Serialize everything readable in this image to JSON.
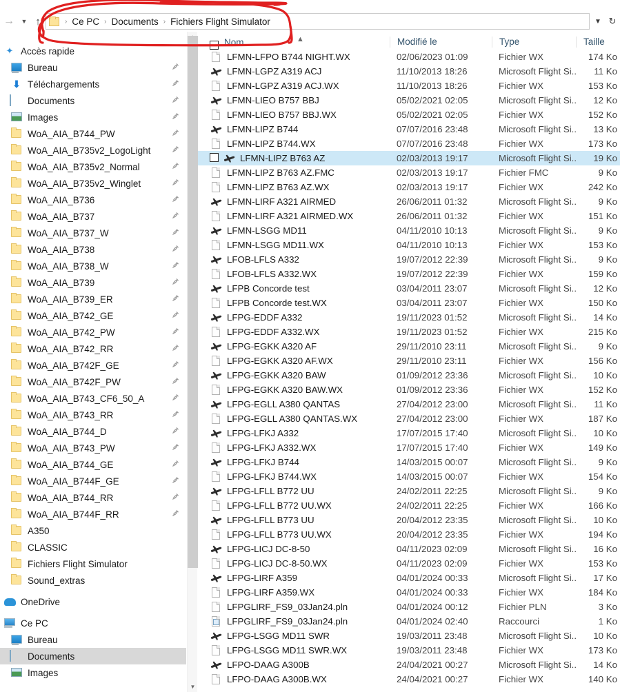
{
  "window": {
    "app": "File Explorer",
    "nav": {
      "back_icon": "arrow-left-icon",
      "forward_icon": "arrow-right-icon",
      "recent_icon": "chevron-down-icon",
      "up_icon": "arrow-up-icon",
      "address_caret_icon": "chevron-down-icon",
      "refresh_icon": "refresh-icon"
    },
    "breadcrumb": {
      "folder_icon": "folder-icon",
      "separator": "›",
      "items": [
        "Ce PC",
        "Documents",
        "Fichiers Flight Simulator"
      ]
    }
  },
  "sidebar": {
    "items": [
      {
        "label": "Accès rapide",
        "icon": "star-icon",
        "indent": 0,
        "pin": false,
        "selected": false
      },
      {
        "label": "Bureau",
        "icon": "desktop-icon",
        "indent": 1,
        "pin": true,
        "selected": false
      },
      {
        "label": "Téléchargements",
        "icon": "download-icon",
        "indent": 1,
        "pin": true,
        "selected": false
      },
      {
        "label": "Documents",
        "icon": "documents-icon",
        "indent": 1,
        "pin": true,
        "selected": false
      },
      {
        "label": "Images",
        "icon": "pictures-icon",
        "indent": 1,
        "pin": true,
        "selected": false
      },
      {
        "label": "WoA_AIA_B744_PW",
        "icon": "folder-icon",
        "indent": 1,
        "pin": true,
        "selected": false
      },
      {
        "label": "WoA_AIA_B735v2_LogoLight",
        "icon": "folder-icon",
        "indent": 1,
        "pin": true,
        "selected": false
      },
      {
        "label": "WoA_AIA_B735v2_Normal",
        "icon": "folder-icon",
        "indent": 1,
        "pin": true,
        "selected": false
      },
      {
        "label": "WoA_AIA_B735v2_Winglet",
        "icon": "folder-icon",
        "indent": 1,
        "pin": true,
        "selected": false
      },
      {
        "label": "WoA_AIA_B736",
        "icon": "folder-icon",
        "indent": 1,
        "pin": true,
        "selected": false
      },
      {
        "label": "WoA_AIA_B737",
        "icon": "folder-icon",
        "indent": 1,
        "pin": true,
        "selected": false
      },
      {
        "label": "WoA_AIA_B737_W",
        "icon": "folder-icon",
        "indent": 1,
        "pin": true,
        "selected": false
      },
      {
        "label": "WoA_AIA_B738",
        "icon": "folder-icon",
        "indent": 1,
        "pin": true,
        "selected": false
      },
      {
        "label": "WoA_AIA_B738_W",
        "icon": "folder-icon",
        "indent": 1,
        "pin": true,
        "selected": false
      },
      {
        "label": "WoA_AIA_B739",
        "icon": "folder-icon",
        "indent": 1,
        "pin": true,
        "selected": false
      },
      {
        "label": "WoA_AIA_B739_ER",
        "icon": "folder-icon",
        "indent": 1,
        "pin": true,
        "selected": false
      },
      {
        "label": "WoA_AIA_B742_GE",
        "icon": "folder-icon",
        "indent": 1,
        "pin": true,
        "selected": false
      },
      {
        "label": "WoA_AIA_B742_PW",
        "icon": "folder-icon",
        "indent": 1,
        "pin": true,
        "selected": false
      },
      {
        "label": "WoA_AIA_B742_RR",
        "icon": "folder-icon",
        "indent": 1,
        "pin": true,
        "selected": false
      },
      {
        "label": "WoA_AIA_B742F_GE",
        "icon": "folder-icon",
        "indent": 1,
        "pin": true,
        "selected": false
      },
      {
        "label": "WoA_AIA_B742F_PW",
        "icon": "folder-icon",
        "indent": 1,
        "pin": true,
        "selected": false
      },
      {
        "label": "WoA_AIA_B743_CF6_50_A",
        "icon": "folder-icon",
        "indent": 1,
        "pin": true,
        "selected": false
      },
      {
        "label": "WoA_AIA_B743_RR",
        "icon": "folder-icon",
        "indent": 1,
        "pin": true,
        "selected": false
      },
      {
        "label": "WoA_AIA_B744_D",
        "icon": "folder-icon",
        "indent": 1,
        "pin": true,
        "selected": false
      },
      {
        "label": "WoA_AIA_B743_PW",
        "icon": "folder-icon",
        "indent": 1,
        "pin": true,
        "selected": false
      },
      {
        "label": "WoA_AIA_B744_GE",
        "icon": "folder-icon",
        "indent": 1,
        "pin": true,
        "selected": false
      },
      {
        "label": "WoA_AIA_B744F_GE",
        "icon": "folder-icon",
        "indent": 1,
        "pin": true,
        "selected": false
      },
      {
        "label": "WoA_AIA_B744_RR",
        "icon": "folder-icon",
        "indent": 1,
        "pin": true,
        "selected": false
      },
      {
        "label": "WoA_AIA_B744F_RR",
        "icon": "folder-icon",
        "indent": 1,
        "pin": true,
        "selected": false
      },
      {
        "label": "A350",
        "icon": "folder-icon",
        "indent": 1,
        "pin": false,
        "selected": false
      },
      {
        "label": "CLASSIC",
        "icon": "folder-icon",
        "indent": 1,
        "pin": false,
        "selected": false
      },
      {
        "label": "Fichiers Flight Simulator",
        "icon": "folder-icon",
        "indent": 1,
        "pin": false,
        "selected": false
      },
      {
        "label": "Sound_extras",
        "icon": "folder-icon",
        "indent": 1,
        "pin": false,
        "selected": false
      },
      {
        "label": "OneDrive",
        "icon": "cloud-icon",
        "indent": 0,
        "pin": false,
        "selected": false,
        "gap_before": true
      },
      {
        "label": "Ce PC",
        "icon": "pc-icon",
        "indent": 0,
        "pin": false,
        "selected": false,
        "gap_before": true
      },
      {
        "label": "Bureau",
        "icon": "desktop-icon",
        "indent": 1,
        "pin": false,
        "selected": false
      },
      {
        "label": "Documents",
        "icon": "documents-icon",
        "indent": 1,
        "pin": false,
        "selected": true
      },
      {
        "label": "Images",
        "icon": "pictures-icon",
        "indent": 1,
        "pin": false,
        "selected": false
      }
    ],
    "scrollbar": {
      "up_icon": "chevron-up-icon",
      "down_icon": "chevron-down-icon"
    }
  },
  "filelist": {
    "columns": [
      "Nom",
      "Modifié le",
      "Type",
      "Taille"
    ],
    "sort_indicator_icon": "sort-ascending-caret-icon",
    "select_all_checkbox": false,
    "rows": [
      {
        "name": "LFMN-LFPO B744 NIGHT.WX",
        "modified": "02/06/2023 01:09",
        "type": "Fichier WX",
        "size": "174 Ko",
        "icon": "file-icon",
        "selected": false
      },
      {
        "name": "LFMN-LGPZ A319 ACJ",
        "modified": "11/10/2013 18:26",
        "type": "Microsoft Flight Si...",
        "size": "11 Ko",
        "icon": "plane-icon",
        "selected": false
      },
      {
        "name": "LFMN-LGPZ A319 ACJ.WX",
        "modified": "11/10/2013 18:26",
        "type": "Fichier WX",
        "size": "153 Ko",
        "icon": "file-icon",
        "selected": false
      },
      {
        "name": "LFMN-LIEO B757 BBJ",
        "modified": "05/02/2021 02:05",
        "type": "Microsoft Flight Si...",
        "size": "12 Ko",
        "icon": "plane-icon",
        "selected": false
      },
      {
        "name": "LFMN-LIEO B757 BBJ.WX",
        "modified": "05/02/2021 02:05",
        "type": "Fichier WX",
        "size": "152 Ko",
        "icon": "file-icon",
        "selected": false
      },
      {
        "name": "LFMN-LIPZ B744",
        "modified": "07/07/2016 23:48",
        "type": "Microsoft Flight Si...",
        "size": "13 Ko",
        "icon": "plane-icon",
        "selected": false
      },
      {
        "name": "LFMN-LIPZ B744.WX",
        "modified": "07/07/2016 23:48",
        "type": "Fichier WX",
        "size": "173 Ko",
        "icon": "file-icon",
        "selected": false
      },
      {
        "name": "LFMN-LIPZ B763 AZ",
        "modified": "02/03/2013 19:17",
        "type": "Microsoft Flight Si...",
        "size": "19 Ko",
        "icon": "plane-icon",
        "selected": true
      },
      {
        "name": "LFMN-LIPZ B763 AZ.FMC",
        "modified": "02/03/2013 19:17",
        "type": "Fichier FMC",
        "size": "9 Ko",
        "icon": "file-icon",
        "selected": false
      },
      {
        "name": "LFMN-LIPZ B763 AZ.WX",
        "modified": "02/03/2013 19:17",
        "type": "Fichier WX",
        "size": "242 Ko",
        "icon": "file-icon",
        "selected": false
      },
      {
        "name": "LFMN-LIRF A321 AIRMED",
        "modified": "26/06/2011 01:32",
        "type": "Microsoft Flight Si...",
        "size": "9 Ko",
        "icon": "plane-icon",
        "selected": false
      },
      {
        "name": "LFMN-LIRF A321 AIRMED.WX",
        "modified": "26/06/2011 01:32",
        "type": "Fichier WX",
        "size": "151 Ko",
        "icon": "file-icon",
        "selected": false
      },
      {
        "name": "LFMN-LSGG MD11",
        "modified": "04/11/2010 10:13",
        "type": "Microsoft Flight Si...",
        "size": "9 Ko",
        "icon": "plane-icon",
        "selected": false
      },
      {
        "name": "LFMN-LSGG MD11.WX",
        "modified": "04/11/2010 10:13",
        "type": "Fichier WX",
        "size": "153 Ko",
        "icon": "file-icon",
        "selected": false
      },
      {
        "name": "LFOB-LFLS A332",
        "modified": "19/07/2012 22:39",
        "type": "Microsoft Flight Si...",
        "size": "9 Ko",
        "icon": "plane-icon",
        "selected": false
      },
      {
        "name": "LFOB-LFLS A332.WX",
        "modified": "19/07/2012 22:39",
        "type": "Fichier WX",
        "size": "159 Ko",
        "icon": "file-icon",
        "selected": false
      },
      {
        "name": "LFPB Concorde test",
        "modified": "03/04/2011 23:07",
        "type": "Microsoft Flight Si...",
        "size": "12 Ko",
        "icon": "plane-icon",
        "selected": false
      },
      {
        "name": "LFPB Concorde test.WX",
        "modified": "03/04/2011 23:07",
        "type": "Fichier WX",
        "size": "150 Ko",
        "icon": "file-icon",
        "selected": false
      },
      {
        "name": "LFPG-EDDF A332",
        "modified": "19/11/2023 01:52",
        "type": "Microsoft Flight Si...",
        "size": "14 Ko",
        "icon": "plane-icon",
        "selected": false
      },
      {
        "name": "LFPG-EDDF A332.WX",
        "modified": "19/11/2023 01:52",
        "type": "Fichier WX",
        "size": "215 Ko",
        "icon": "file-icon",
        "selected": false
      },
      {
        "name": "LFPG-EGKK A320 AF",
        "modified": "29/11/2010 23:11",
        "type": "Microsoft Flight Si...",
        "size": "9 Ko",
        "icon": "plane-icon",
        "selected": false
      },
      {
        "name": "LFPG-EGKK A320 AF.WX",
        "modified": "29/11/2010 23:11",
        "type": "Fichier WX",
        "size": "156 Ko",
        "icon": "file-icon",
        "selected": false
      },
      {
        "name": "LFPG-EGKK A320 BAW",
        "modified": "01/09/2012 23:36",
        "type": "Microsoft Flight Si...",
        "size": "10 Ko",
        "icon": "plane-icon",
        "selected": false
      },
      {
        "name": "LFPG-EGKK A320 BAW.WX",
        "modified": "01/09/2012 23:36",
        "type": "Fichier WX",
        "size": "152 Ko",
        "icon": "file-icon",
        "selected": false
      },
      {
        "name": "LFPG-EGLL A380 QANTAS",
        "modified": "27/04/2012 23:00",
        "type": "Microsoft Flight Si...",
        "size": "11 Ko",
        "icon": "plane-icon",
        "selected": false
      },
      {
        "name": "LFPG-EGLL A380 QANTAS.WX",
        "modified": "27/04/2012 23:00",
        "type": "Fichier WX",
        "size": "187 Ko",
        "icon": "file-icon",
        "selected": false
      },
      {
        "name": "LFPG-LFKJ A332",
        "modified": "17/07/2015 17:40",
        "type": "Microsoft Flight Si...",
        "size": "10 Ko",
        "icon": "plane-icon",
        "selected": false
      },
      {
        "name": "LFPG-LFKJ A332.WX",
        "modified": "17/07/2015 17:40",
        "type": "Fichier WX",
        "size": "149 Ko",
        "icon": "file-icon",
        "selected": false
      },
      {
        "name": "LFPG-LFKJ B744",
        "modified": "14/03/2015 00:07",
        "type": "Microsoft Flight Si...",
        "size": "9 Ko",
        "icon": "plane-icon",
        "selected": false
      },
      {
        "name": "LFPG-LFKJ B744.WX",
        "modified": "14/03/2015 00:07",
        "type": "Fichier WX",
        "size": "154 Ko",
        "icon": "file-icon",
        "selected": false
      },
      {
        "name": "LFPG-LFLL B772 UU",
        "modified": "24/02/2011 22:25",
        "type": "Microsoft Flight Si...",
        "size": "9 Ko",
        "icon": "plane-icon",
        "selected": false
      },
      {
        "name": "LFPG-LFLL B772 UU.WX",
        "modified": "24/02/2011 22:25",
        "type": "Fichier WX",
        "size": "166 Ko",
        "icon": "file-icon",
        "selected": false
      },
      {
        "name": "LFPG-LFLL B773 UU",
        "modified": "20/04/2012 23:35",
        "type": "Microsoft Flight Si...",
        "size": "10 Ko",
        "icon": "plane-icon",
        "selected": false
      },
      {
        "name": "LFPG-LFLL B773 UU.WX",
        "modified": "20/04/2012 23:35",
        "type": "Fichier WX",
        "size": "194 Ko",
        "icon": "file-icon",
        "selected": false
      },
      {
        "name": "LFPG-LICJ DC-8-50",
        "modified": "04/11/2023 02:09",
        "type": "Microsoft Flight Si...",
        "size": "16 Ko",
        "icon": "plane-icon",
        "selected": false
      },
      {
        "name": "LFPG-LICJ DC-8-50.WX",
        "modified": "04/11/2023 02:09",
        "type": "Fichier WX",
        "size": "153 Ko",
        "icon": "file-icon",
        "selected": false
      },
      {
        "name": "LFPG-LIRF A359",
        "modified": "04/01/2024 00:33",
        "type": "Microsoft Flight Si...",
        "size": "17 Ko",
        "icon": "plane-icon",
        "selected": false
      },
      {
        "name": "LFPG-LIRF A359.WX",
        "modified": "04/01/2024 00:33",
        "type": "Fichier WX",
        "size": "184 Ko",
        "icon": "file-icon",
        "selected": false
      },
      {
        "name": "LFPGLIRF_FS9_03Jan24.pln",
        "modified": "04/01/2024 00:12",
        "type": "Fichier PLN",
        "size": "3 Ko",
        "icon": "file-icon",
        "selected": false
      },
      {
        "name": "LFPGLIRF_FS9_03Jan24.pln",
        "modified": "04/01/2024 02:40",
        "type": "Raccourci",
        "size": "1 Ko",
        "icon": "shortcut-icon",
        "selected": false
      },
      {
        "name": "LFPG-LSGG MD11 SWR",
        "modified": "19/03/2011 23:48",
        "type": "Microsoft Flight Si...",
        "size": "10 Ko",
        "icon": "plane-icon",
        "selected": false
      },
      {
        "name": "LFPG-LSGG MD11 SWR.WX",
        "modified": "19/03/2011 23:48",
        "type": "Fichier WX",
        "size": "173 Ko",
        "icon": "file-icon",
        "selected": false
      },
      {
        "name": "LFPO-DAAG A300B",
        "modified": "24/04/2021 00:27",
        "type": "Microsoft Flight Si...",
        "size": "14 Ko",
        "icon": "plane-icon",
        "selected": false
      },
      {
        "name": "LFPO-DAAG A300B.WX",
        "modified": "24/04/2021 00:27",
        "type": "Fichier WX",
        "size": "140 Ko",
        "icon": "file-icon",
        "selected": false
      }
    ]
  },
  "annotation": {
    "shape": "hand-drawn-ellipse",
    "color": "#e02020",
    "target": "breadcrumb-address-bar"
  }
}
